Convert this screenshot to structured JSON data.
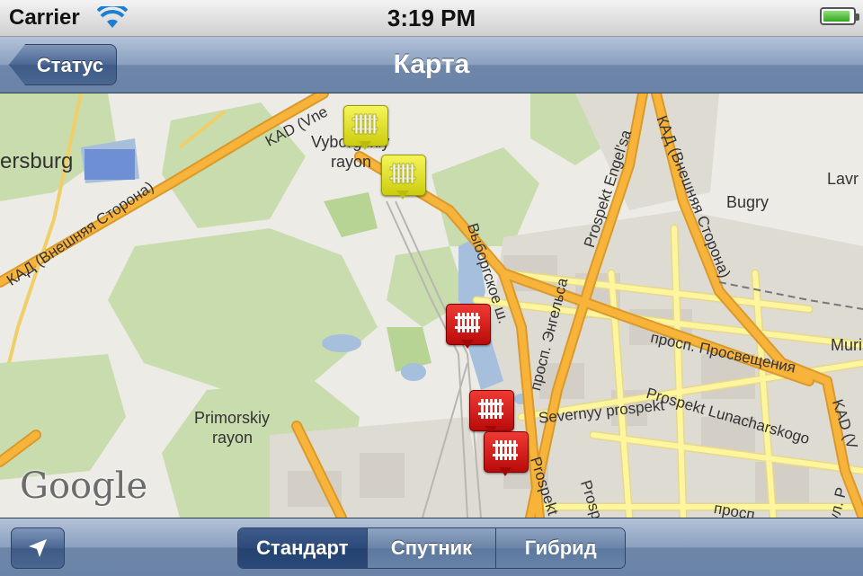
{
  "status_bar": {
    "carrier": "Carrier",
    "time": "3:19 PM"
  },
  "nav": {
    "back_label": "Статус",
    "title": "Карта"
  },
  "map": {
    "place_labels": [
      "ersburg",
      "Vyborgskiy",
      "rayon",
      "Bugry",
      "Lavr",
      "Muri",
      "Primorskiy",
      "rayon"
    ],
    "road_labels": [
      "KAD (Vne",
      "КАД (Внешняя Сторона)",
      "КАД (Внешняя Сторона)",
      "Выборгское ш.",
      "Prospekt Engel'sa",
      "просп. Энгельса",
      "просп. Просвещения",
      "Prospekt Lunacharskogo",
      "Severnyy prospekt",
      "Prospekt E",
      "Prospekt T",
      "просп",
      "ул. Р",
      "KAD (V"
    ],
    "attribution": "Google",
    "pins": [
      {
        "color": "yellow",
        "icon": "radiator-icon"
      },
      {
        "color": "yellow",
        "icon": "radiator-icon"
      },
      {
        "color": "red",
        "icon": "radiator-icon"
      },
      {
        "color": "red",
        "icon": "radiator-icon"
      },
      {
        "color": "red",
        "icon": "radiator-icon"
      }
    ]
  },
  "toolbar": {
    "locate_icon": "location-arrow-icon",
    "segments": [
      "Стандарт",
      "Спутник",
      "Гибрид"
    ],
    "selected": "Стандарт"
  },
  "colors": {
    "bar_blue": "#6d86aa",
    "road_major": "#f8b33b",
    "road_minor": "#fef59e",
    "pin_red": "#d31a16",
    "pin_yellow": "#e6e62a",
    "battery_green": "#4cb82f"
  }
}
